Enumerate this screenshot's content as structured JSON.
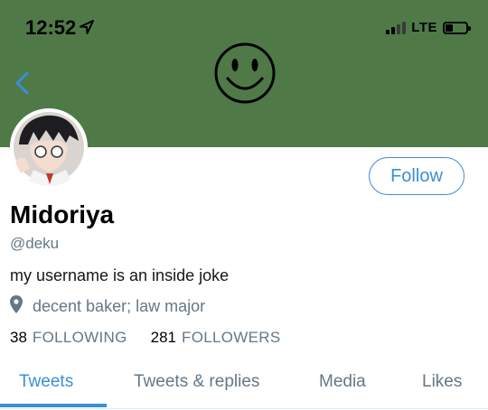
{
  "status_bar": {
    "time": "12:52",
    "network": "LTE",
    "location_icon": "location-arrow-icon",
    "battery_level_fraction": 0.3
  },
  "header": {
    "back_icon": "chevron-left-icon",
    "banner_image": "smiley-face",
    "banner_color": "#4f7a48"
  },
  "profile": {
    "name": "Midoriya",
    "handle": "@deku",
    "bio": "my username is an inside joke",
    "location": "decent baker; law major",
    "following_count": "38",
    "following_label": "FOLLOWING",
    "followers_count": "281",
    "followers_label": "FOLLOWERS"
  },
  "follow_button": {
    "label": "Follow"
  },
  "tabs": [
    {
      "label": "Tweets",
      "active": true
    },
    {
      "label": "Tweets & replies"
    },
    {
      "label": "Media"
    },
    {
      "label": "Likes"
    }
  ],
  "colors": {
    "accent": "#3a8fd6",
    "muted": "#657786",
    "banner": "#4f7a48"
  }
}
